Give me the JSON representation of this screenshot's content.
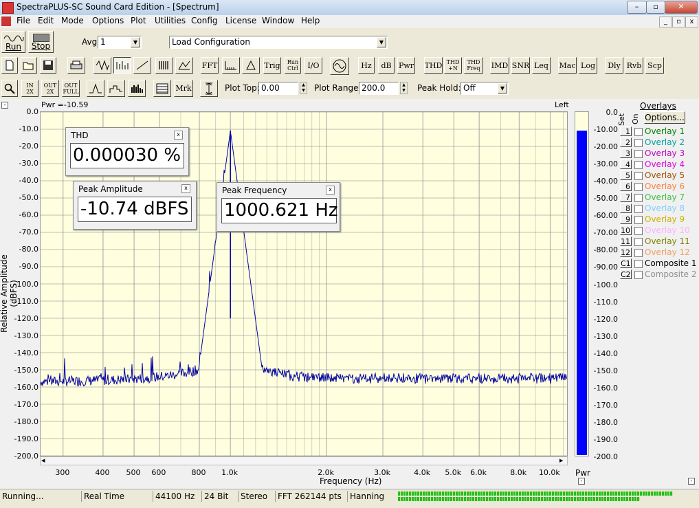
{
  "window": {
    "title": "SpectraPLUS-SC Sound Card Edition - [Spectrum]"
  },
  "menu": [
    "File",
    "Edit",
    "Mode",
    "Options",
    "Plot",
    "Utilities",
    "Config",
    "License",
    "Window",
    "Help"
  ],
  "toolbar1": {
    "run": "Run",
    "stop": "Stop",
    "avg_label": "Avg",
    "avg_value": "1",
    "config_value": "Load Configuration"
  },
  "toolbar2": [
    "FFT",
    "Trig",
    "Run Ctrl",
    "I/O",
    "Hz",
    "dB",
    "Pwr",
    "THD",
    "THD +N",
    "THD Freq",
    "IMD",
    "SNR",
    "Leq",
    "Mac",
    "Log",
    "Dly",
    "Rvb",
    "Scp"
  ],
  "toolbar3": {
    "zoom_in": "IN 2X",
    "zoom_out": "OUT 2X",
    "zoom_full": "OUT FULL",
    "mrk": "Mrk",
    "plot_top_label": "Plot Top:",
    "plot_top_value": "0.00",
    "plot_range_label": "Plot Range:",
    "plot_range_value": "200.0",
    "peak_hold_label": "Peak Hold:",
    "peak_hold_value": "Off"
  },
  "plot": {
    "header_left": "Pwr =-10.59",
    "header_right": "Left",
    "ylabel": "Relative Amplitude (dBFS)",
    "xlabel": "Frequency (Hz)",
    "yticks": [
      "0.0",
      "-10.0",
      "-20.0",
      "-30.0",
      "-40.0",
      "-50.0",
      "-60.0",
      "-70.0",
      "-80.0",
      "-90.0",
      "-100.0",
      "-110.0",
      "-120.0",
      "-130.0",
      "-140.0",
      "-150.0",
      "-160.0",
      "-170.0",
      "-180.0",
      "-190.0",
      "-200.0"
    ],
    "xticks": [
      "300",
      "400",
      "500",
      "600",
      "800",
      "1.0k",
      "2.0k",
      "3.0k",
      "4.0k",
      "5.0k",
      "6.0k",
      "8.0k",
      "10.0k"
    ],
    "meter_ticks": [
      "0.0",
      "-10.00",
      "-20.00",
      "-30.00",
      "-40.00",
      "-50.00",
      "-60.00",
      "-70.00",
      "-80.00",
      "-90.00",
      "-100.0",
      "-110.0",
      "-120.0",
      "-130.0",
      "-140.0",
      "-150.0",
      "-160.0",
      "-170.0",
      "-180.0",
      "-190.0",
      "-200.0"
    ],
    "meter_label": "Pwr",
    "meter_level_db": -10.59
  },
  "readouts": {
    "thd": {
      "title": "THD",
      "value": "0.000030 %"
    },
    "amp": {
      "title": "Peak Amplitude",
      "value": "-10.74 dBFS"
    },
    "freq": {
      "title": "Peak Frequency",
      "value": "1000.621 Hz"
    }
  },
  "overlays": {
    "title": "Overlays",
    "set_label": "Set",
    "on_label": "On",
    "options": "Options...",
    "items": [
      {
        "num": "1",
        "name": "Overlay 1",
        "color": "#008000"
      },
      {
        "num": "2",
        "name": "Overlay 2",
        "color": "#00a0a0"
      },
      {
        "num": "3",
        "name": "Overlay 3",
        "color": "#c000c0"
      },
      {
        "num": "4",
        "name": "Overlay 4",
        "color": "#e000e0"
      },
      {
        "num": "5",
        "name": "Overlay 5",
        "color": "#a05000"
      },
      {
        "num": "6",
        "name": "Overlay 6",
        "color": "#ff8040"
      },
      {
        "num": "7",
        "name": "Overlay 7",
        "color": "#40c040"
      },
      {
        "num": "8",
        "name": "Overlay 8",
        "color": "#80d0ff"
      },
      {
        "num": "9",
        "name": "Overlay 9",
        "color": "#d0b000"
      },
      {
        "num": "10",
        "name": "Overlay 10",
        "color": "#ffb0ff"
      },
      {
        "num": "11",
        "name": "Overlay 11",
        "color": "#808000"
      },
      {
        "num": "12",
        "name": "Overlay 12",
        "color": "#f0a060"
      },
      {
        "num": "C1",
        "name": "Composite 1",
        "color": "#000000"
      },
      {
        "num": "C2",
        "name": "Composite 2",
        "color": "#909090"
      }
    ]
  },
  "status": [
    "Running...",
    "Real Time",
    "44100 Hz",
    "24 Bit",
    "Stereo",
    "FFT 262144 pts",
    "Hanning"
  ],
  "colors": {
    "trace": "#0000a0",
    "plot_bg": "#ffffe0",
    "meter": "#0000ff",
    "grid": "#808080"
  }
}
